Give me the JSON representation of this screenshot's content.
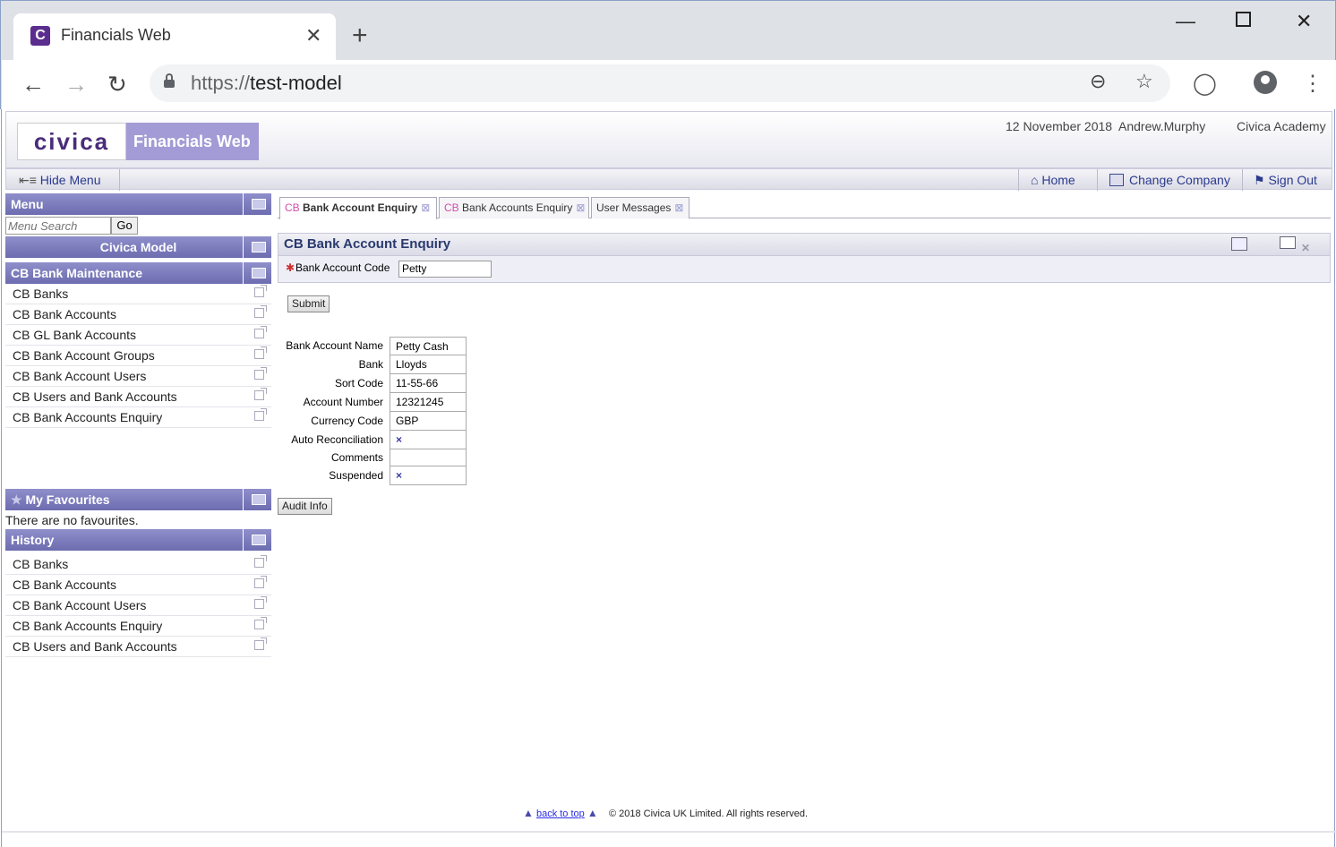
{
  "browser": {
    "tab_title": "Financials Web",
    "tab_favicon": "C",
    "url_protocol": "https://",
    "url_host": "test-model"
  },
  "banner": {
    "logo_text": "civica",
    "app_name": "Financials Web",
    "date": "12 November 2018",
    "user": "Andrew.Murphy",
    "company": "Civica Academy"
  },
  "menubar": {
    "hide_menu": "Hide Menu",
    "home": "Home",
    "change_company": "Change Company",
    "sign_out": "Sign Out"
  },
  "sidebar": {
    "menu_title": "Menu",
    "search_placeholder": "Menu Search",
    "go_label": "Go",
    "model_title": "Civica Model",
    "section_title": "CB Bank Maintenance",
    "items": [
      "CB Banks",
      "CB Bank Accounts",
      "CB GL Bank Accounts",
      "CB Bank Account Groups",
      "CB Bank Account Users",
      "CB Users and Bank Accounts",
      "CB Bank Accounts Enquiry"
    ],
    "favourites_title": "My Favourites",
    "favourites_empty": "There are no favourites.",
    "history_title": "History",
    "history": [
      "CB Banks",
      "CB Bank Accounts",
      "CB Bank Account Users",
      "CB Bank Accounts Enquiry",
      "CB Users and Bank Accounts"
    ]
  },
  "content_tabs": [
    {
      "prefix": "CB",
      "label": "Bank Account Enquiry"
    },
    {
      "prefix": "CB",
      "label": "Bank Accounts Enquiry"
    },
    {
      "prefix": "",
      "label": "User Messages"
    }
  ],
  "enquiry": {
    "title": "CB Bank Account Enquiry",
    "code_label": "Bank Account Code",
    "code_value": "Petty",
    "submit_label": "Submit",
    "audit_label": "Audit Info",
    "fields": [
      {
        "label": "Bank Account Name",
        "value": "Petty Cash"
      },
      {
        "label": "Bank",
        "value": "Lloyds"
      },
      {
        "label": "Sort Code",
        "value": "11-55-66"
      },
      {
        "label": "Account Number",
        "value": "12321245"
      },
      {
        "label": "Currency Code",
        "value": "GBP"
      },
      {
        "label": "Auto Reconciliation",
        "value": "×"
      },
      {
        "label": "Comments",
        "value": ""
      },
      {
        "label": "Suspended",
        "value": "×"
      }
    ]
  },
  "footer": {
    "back_to_top": "back to top",
    "copyright": "© 2018 Civica UK Limited. All rights reserved."
  }
}
